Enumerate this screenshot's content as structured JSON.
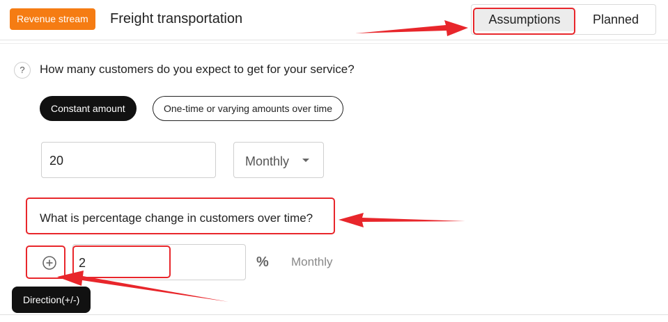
{
  "header": {
    "badge_label": "Revenue stream",
    "title": "Freight transportation",
    "tabs": [
      {
        "label": "Assumptions",
        "active": true
      },
      {
        "label": "Planned",
        "active": false
      }
    ]
  },
  "question1": {
    "help_icon_label": "?",
    "text": "How many customers do you expect to get for your service?",
    "modes": [
      {
        "label": "Constant amount",
        "selected": true
      },
      {
        "label": "One-time or varying amounts over time",
        "selected": false
      }
    ],
    "amount_value": "20",
    "period_value": "Monthly"
  },
  "question2": {
    "text": "What is percentage change in customers over time?",
    "direction_icon": "plus-circle-icon",
    "growth_value": "2",
    "unit_icon": "percent-icon",
    "unit_symbol": "%",
    "period_label": "Monthly"
  },
  "tooltip": {
    "text": "Direction(+/-)"
  },
  "colors": {
    "accent_orange": "#f57c13",
    "annotation_red": "#e8262b",
    "pill_dark": "#111111"
  }
}
